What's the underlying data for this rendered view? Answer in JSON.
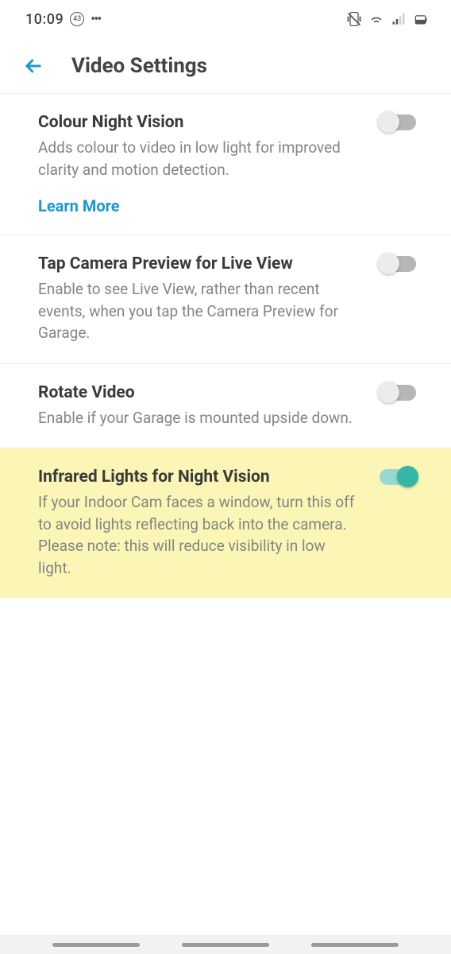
{
  "status": {
    "time": "10:09",
    "badge": "43"
  },
  "header": {
    "title": "Video Settings"
  },
  "items": [
    {
      "title": "Colour Night Vision",
      "desc": "Adds colour to video in low light for improved clarity and motion detection.",
      "learn_more": "Learn More",
      "on": false,
      "highlighted": false
    },
    {
      "title": "Tap Camera Preview for Live View",
      "desc": "Enable to see Live View, rather than recent events, when you tap the Camera Preview for Garage.",
      "learn_more": null,
      "on": false,
      "highlighted": false
    },
    {
      "title": "Rotate Video",
      "desc": "Enable if your Garage is mounted upside down.",
      "learn_more": null,
      "on": false,
      "highlighted": false
    },
    {
      "title": "Infrared Lights for Night Vision",
      "desc": "If your Indoor Cam faces a window, turn this off to avoid lights reflecting back into the camera. Please note: this will reduce visibility in low light.",
      "learn_more": null,
      "on": true,
      "highlighted": true
    }
  ]
}
